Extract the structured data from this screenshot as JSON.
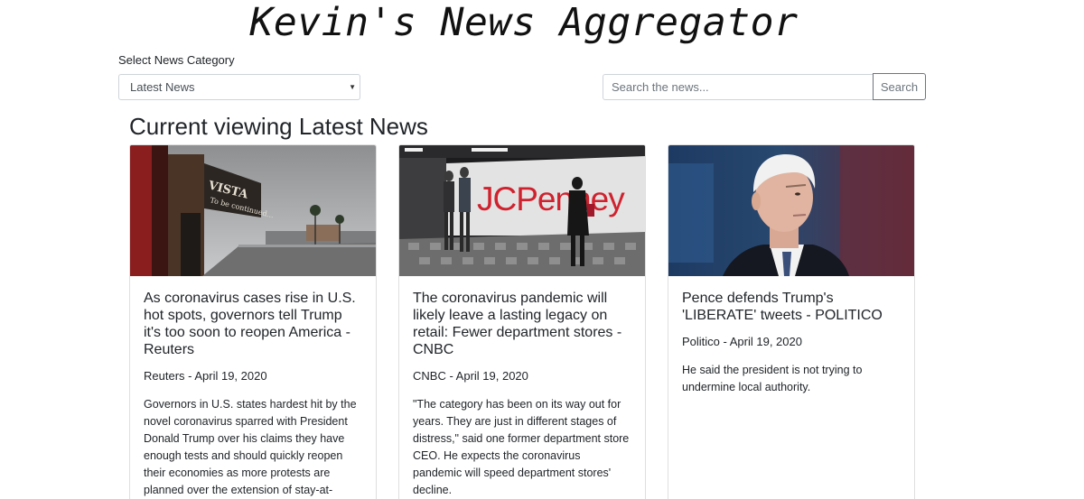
{
  "site": {
    "title": "Kevin's News Aggregator"
  },
  "category": {
    "label": "Select News Category",
    "selected": "Latest News"
  },
  "search": {
    "placeholder": "Search the news...",
    "button_label": "Search"
  },
  "main": {
    "heading": "Current viewing Latest News"
  },
  "articles": [
    {
      "title": "As coronavirus cases rise in U.S. hot spots, governors tell Trump it's too soon to reopen America - Reuters",
      "meta": "Reuters - April 19, 2020",
      "description": "Governors in U.S. states hardest hit by the novel coronavirus sparred with President Donald Trump over his claims they have enough tests and should quickly reopen their economies as more protests are planned over the extension of stay-at-"
    },
    {
      "title": "The coronavirus pandemic will likely leave a lasting legacy on retail: Fewer department stores - CNBC",
      "meta": "CNBC - April 19, 2020",
      "description": "\"The category has been on its way out for years. They are just in different stages of distress,\" said one former department store CEO. He expects the coronavirus pandemic will speed department stores' decline."
    },
    {
      "title": "Pence defends Trump's 'LIBERATE' tweets - POLITICO",
      "meta": "Politico - April 19, 2020",
      "description": "He said the president is not trying to undermine local authority."
    }
  ],
  "images": {
    "article_1": {
      "sign_text": "VISTA",
      "marquee_text": "To be continued..."
    },
    "article_2": {
      "logo_text": "JCPenney",
      "logo_color": "#d0222e"
    },
    "article_3": {}
  }
}
